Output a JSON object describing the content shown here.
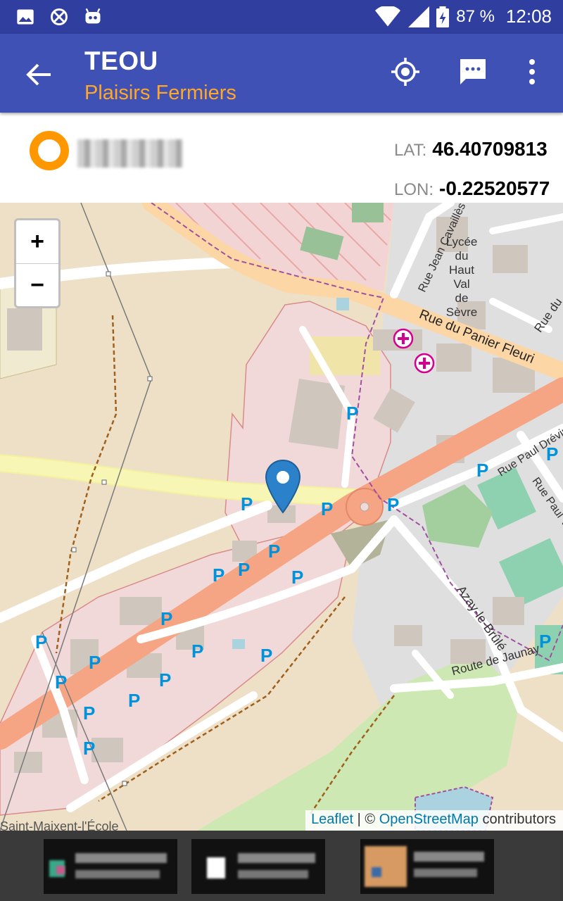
{
  "status_bar": {
    "battery": "87 %",
    "time": "12:08",
    "icons": [
      "image-icon",
      "app-icon",
      "robot-icon",
      "wifi-icon",
      "signal-icon",
      "battery-icon"
    ]
  },
  "app_bar": {
    "title": "TEOU",
    "subtitle": "Plaisirs Fermiers",
    "actions": [
      "locate-icon",
      "message-icon",
      "more-vert-icon"
    ],
    "colors": {
      "primary": "#3f51b5",
      "primary_dark": "#303f9f",
      "accent": "#ffa726"
    }
  },
  "info_panel": {
    "lat_label": "LAT:",
    "lat_value": "46.40709813",
    "lon_label": "LON:",
    "lon_value": "-0.22520577"
  },
  "map": {
    "zoom_in": "+",
    "zoom_out": "−",
    "labels": {
      "lycee": [
        "Lycée",
        "du",
        "Haut",
        "Val",
        "de",
        "Sèvre"
      ],
      "rue_jean": "Rue Jean Cavaillès",
      "rue_panier": "Rue du Panier Fleuri",
      "rue_du": "Rue du",
      "rue_paul_drevin": "Rue Paul Drévin",
      "rue_paul_ve": "Rue Paul Ve",
      "azay": "Azay-le-Brûlé",
      "route_jaunay": "Route de Jaunay",
      "saint_maixent": "Saint-Maixent-l'École"
    },
    "parking_letter": "P",
    "attribution": {
      "leaflet": "Leaflet",
      "sep": " | © ",
      "osm": "OpenStreetMap",
      "rest": " contributors"
    }
  }
}
